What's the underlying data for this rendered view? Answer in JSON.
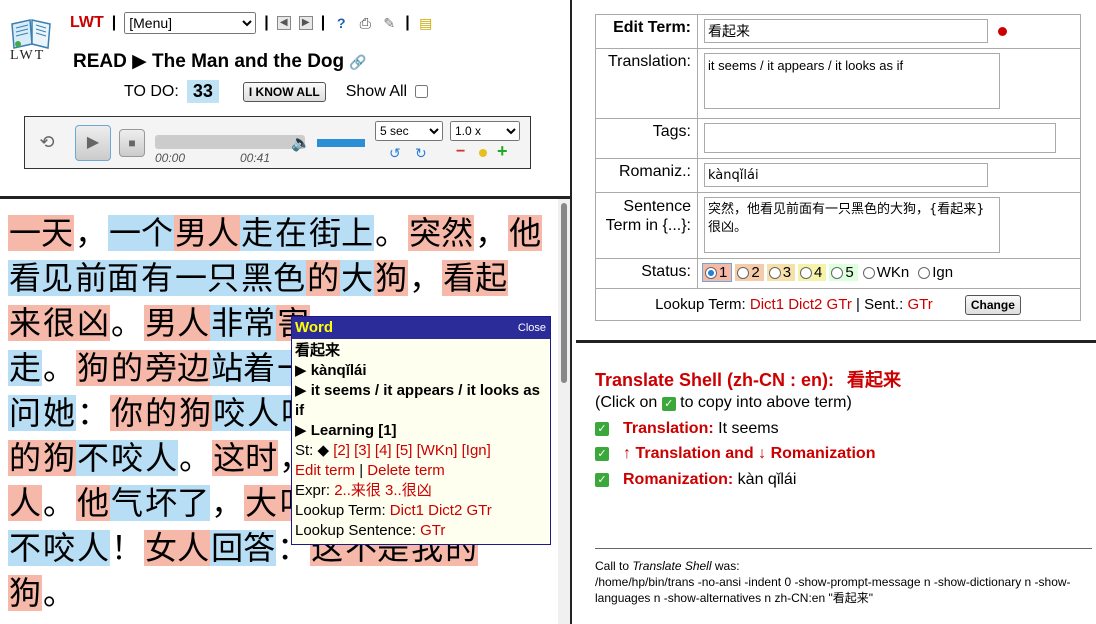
{
  "header": {
    "lwt_link": "LWT",
    "logo_text": "LWT",
    "menu_value": "[Menu]",
    "read_label": "READ ▶",
    "title": "The Man and the Dog",
    "todo_label": "TO DO:",
    "todo_count": "33",
    "i_know_all": "I KNOW ALL",
    "show_all": "Show All",
    "player": {
      "time_current": "00:00",
      "time_total": "00:41",
      "skip": "5 sec",
      "speed": "1.0 x"
    }
  },
  "reading": {
    "words": [
      {
        "t": "一天",
        "s": "s1"
      },
      {
        "t": "，"
      },
      {
        "t": "一个",
        "s": "s0"
      },
      {
        "t": "男人",
        "s": "s1"
      },
      {
        "t": "走",
        "s": "s0"
      },
      {
        "t": "在",
        "s": "s0"
      },
      {
        "t": "街上",
        "s": "s0"
      },
      {
        "t": "。"
      },
      {
        "t": "突然",
        "s": "s1"
      },
      {
        "t": "，"
      },
      {
        "t": "他",
        "s": "s1"
      },
      {
        "t": "看见",
        "s": "s0"
      },
      {
        "t": "前面",
        "s": "s0"
      },
      {
        "t": "有",
        "s": "s0"
      },
      {
        "t": "一只",
        "s": "s0"
      },
      {
        "t": "黑色",
        "s": "s0"
      },
      {
        "t": "的",
        "s": "s1"
      },
      {
        "t": "大",
        "s": "s0"
      },
      {
        "t": "狗",
        "s": "s1"
      },
      {
        "t": "，"
      },
      {
        "t": "看起",
        "s": "s1"
      },
      {
        "t": "来",
        "s": "s1"
      },
      {
        "t": "很",
        "s": "s1"
      },
      {
        "t": "凶",
        "s": "s1"
      },
      {
        "t": "。"
      },
      {
        "t": "男人",
        "s": "s1"
      },
      {
        "t": "非常",
        "s": "s0"
      },
      {
        "t": "害",
        "s": "s1"
      },
      {
        "t": "走",
        "s": "s0"
      },
      {
        "t": "。"
      },
      {
        "t": "狗",
        "s": "s1"
      },
      {
        "t": "的",
        "s": "s1"
      },
      {
        "t": "旁边",
        "s": "s1"
      },
      {
        "t": "站着",
        "s": "s0"
      },
      {
        "t": "一",
        "s": "s0"
      },
      {
        "t": "问",
        "s": "s0"
      },
      {
        "t": "她",
        "s": "s0"
      },
      {
        "t": "："
      },
      {
        "t": "你",
        "s": "s1"
      },
      {
        "t": "的",
        "s": "s1"
      },
      {
        "t": "狗",
        "s": "s1"
      },
      {
        "t": "咬",
        "s": "s0"
      },
      {
        "t": "人",
        "s": "s0"
      },
      {
        "t": "吗",
        "s": "s0"
      },
      {
        "t": "的",
        "s": "s1"
      },
      {
        "t": "狗",
        "s": "s1"
      },
      {
        "t": "不",
        "s": "s0"
      },
      {
        "t": "咬",
        "s": "s0"
      },
      {
        "t": "人",
        "s": "s0"
      },
      {
        "t": "。"
      },
      {
        "t": "这时",
        "s": "s1"
      },
      {
        "t": "，"
      },
      {
        "t": "人",
        "s": "s1"
      },
      {
        "t": "。"
      },
      {
        "t": "他",
        "s": "s1"
      },
      {
        "t": "气",
        "s": "s0"
      },
      {
        "t": "坏了",
        "s": "s0"
      },
      {
        "t": "，"
      },
      {
        "t": "大",
        "s": "s1"
      },
      {
        "t": "叫",
        "s": "s1"
      },
      {
        "t": "不",
        "s": "s0"
      },
      {
        "t": "咬",
        "s": "s0"
      },
      {
        "t": "人",
        "s": "s0"
      },
      {
        "t": "！"
      },
      {
        "t": "女人",
        "s": "s1"
      },
      {
        "t": "回答",
        "s": "s0"
      },
      {
        "t": "："
      },
      {
        "t": "这",
        "s": "s1"
      },
      {
        "t": "不是",
        "s": "s1"
      },
      {
        "t": "我",
        "s": "s1"
      },
      {
        "t": "的",
        "s": "s1"
      },
      {
        "t": "狗",
        "s": "s1"
      },
      {
        "t": "。"
      }
    ],
    "lines": [
      11,
      10,
      7,
      7,
      9,
      8,
      8,
      11,
      2
    ]
  },
  "popup": {
    "title": "Word",
    "close": "Close",
    "term": "看起来",
    "romanization": "▶ kànqǐlái",
    "translation": "▶ it seems / it appears / it looks as if",
    "status_line": "▶ Learning [1]",
    "st_label": "St: ◆",
    "st_links": "[2] [3] [4] [5] [WKn] [Ign]",
    "edit_term": "Edit term",
    "pipe": "|",
    "delete_term": "Delete term",
    "expr_label": "Expr:",
    "expr_value": "2..来很 3..很凶",
    "lookup_term_label": "Lookup Term:",
    "lookup_term_links": "Dict1 Dict2 GTr",
    "lookup_sentence_label": "Lookup Sentence:",
    "lookup_sentence_link": "GTr"
  },
  "edit": {
    "edit_term_label": "Edit Term:",
    "term_value": "看起来",
    "translation_label": "Translation:",
    "translation_value": "it seems / it appears / it looks as if",
    "tags_label": "Tags:",
    "romaniz_label": "Romaniz.:",
    "romaniz_value": "kànqǐlái",
    "sentence_label": "Sentence Term in {...}:",
    "sentence_value": "突然，他看见前面有一只黑色的大狗，{看起来}很凶。",
    "status_label": "Status:",
    "statuses": [
      "1",
      "2",
      "3",
      "4",
      "5",
      "WKn",
      "Ign"
    ],
    "status_colors": [
      "#f5b8a9",
      "#f5cca9",
      "#f5e1a9",
      "#f5f3a9",
      "#ddffdd",
      "#ffffff",
      "#ffffff"
    ],
    "lookup_label": "Lookup Term:",
    "lookup_links": "Dict1 Dict2 GTr",
    "sent_label": "| Sent.:",
    "sent_link": "GTr",
    "change_button": "Change"
  },
  "dict": {
    "title": "Translate Shell (zh-CN : en):",
    "title_term": "看起来",
    "note_before": "(Click on",
    "note_after": "to copy into above term)",
    "translation_label": "Translation:",
    "translation_value": "It seems",
    "trans_rom_label": "↑ Translation and ↓ Romanization",
    "romanization_label": "Romanization:",
    "romanization_value": "kàn qǐlái",
    "call_label_1": "Call to",
    "call_label_em": "Translate Shell",
    "call_label_2": "was:",
    "call_cmd": "/home/hp/bin/trans -no-ansi -indent 0 -show-prompt-message n -show-dictionary n -show-languages n -show-alternatives n zh-CN:en \"看起来\""
  }
}
